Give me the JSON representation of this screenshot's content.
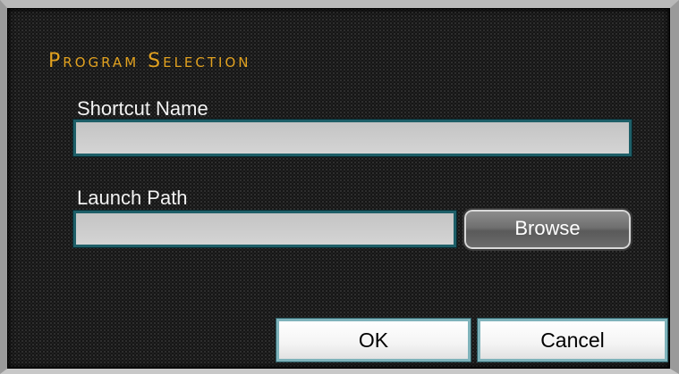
{
  "dialog": {
    "title": "Program Selection"
  },
  "shortcut": {
    "label": "Shortcut Name",
    "value": ""
  },
  "launch": {
    "label": "Launch Path",
    "value": "",
    "browse_label": "Browse"
  },
  "actions": {
    "ok_label": "OK",
    "cancel_label": "Cancel"
  },
  "colors": {
    "title": "#e1a11f",
    "field_border": "#1e5f68",
    "background": "#141414"
  }
}
